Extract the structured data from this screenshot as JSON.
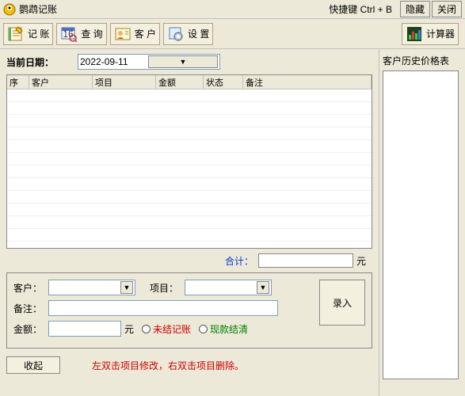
{
  "titlebar": {
    "app_name": "鹦鹉记账",
    "shortcut": "快捷键 Ctrl + B",
    "hide": "隐藏",
    "close": "关闭"
  },
  "toolbar": {
    "record": "记 账",
    "query": "查 询",
    "customer": "客 户",
    "settings": "设 置",
    "calculator": "计算器"
  },
  "date": {
    "label": "当前日期：",
    "value": "2022-09-11"
  },
  "grid": {
    "columns": [
      "序",
      "客户",
      "项目",
      "金额",
      "状态",
      "备注"
    ],
    "rows": []
  },
  "total": {
    "label": "合计：",
    "value": "",
    "unit": "元"
  },
  "entry": {
    "customer_label": "客户：",
    "customer_value": "",
    "project_label": "项目：",
    "project_value": "",
    "remark_label": "备注：",
    "remark_value": "",
    "amount_label": "金额：",
    "amount_value": "",
    "amount_unit": "元",
    "radio_unpaid": "未结记账",
    "radio_paid": "现款结清",
    "submit": "录入"
  },
  "bottom": {
    "collapse": "收起",
    "hint": "左双击项目修改，右双击项目删除。"
  },
  "history": {
    "label": "客户历史价格表",
    "items": []
  }
}
